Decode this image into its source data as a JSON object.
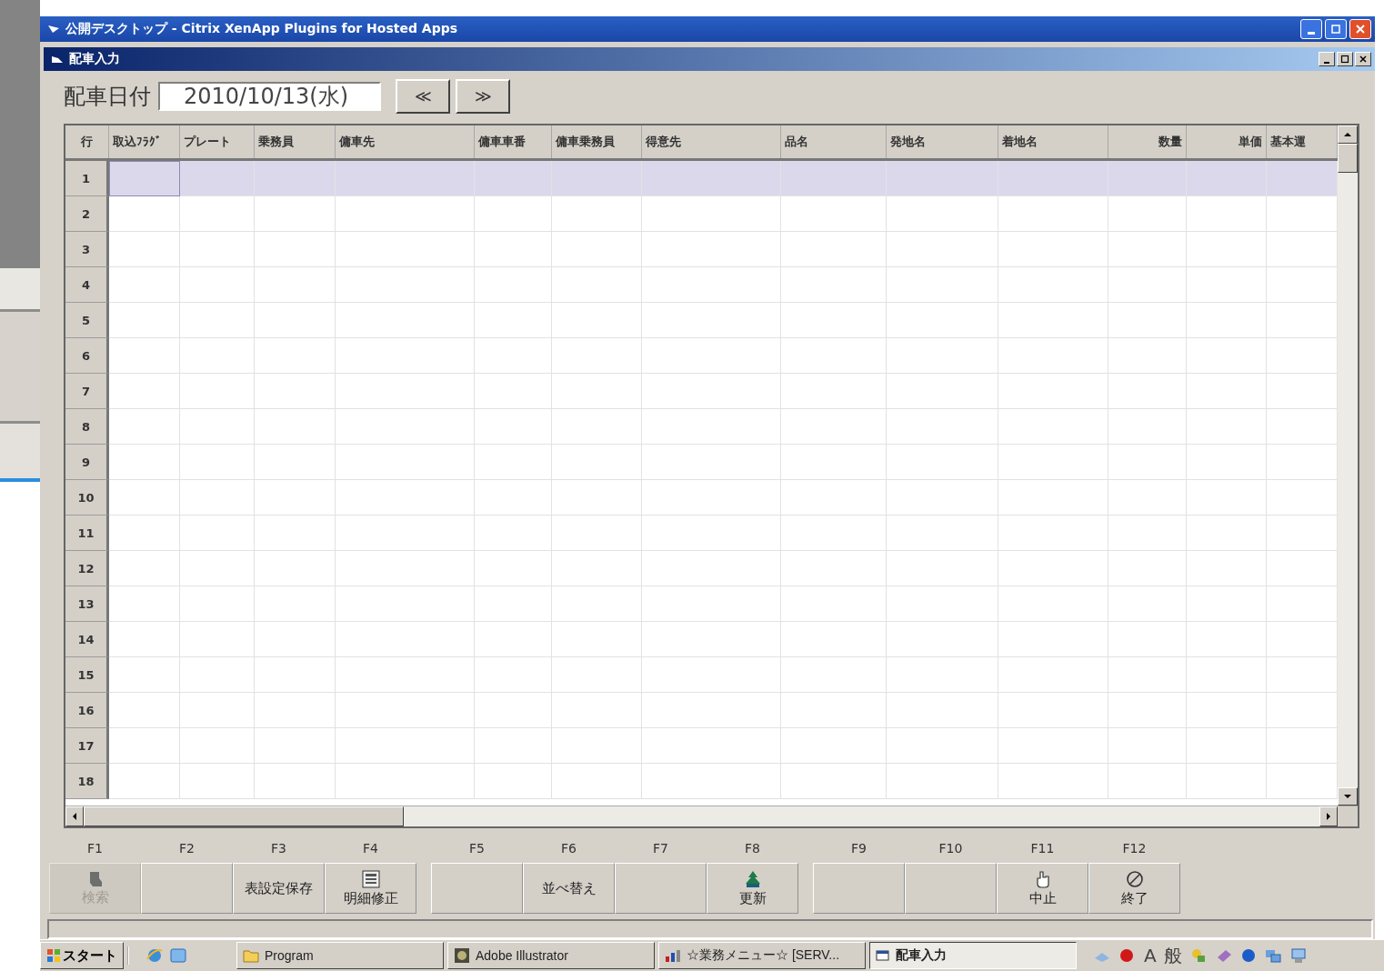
{
  "outer_window": {
    "title": "公開デスクトップ - Citrix XenApp Plugins for Hosted Apps"
  },
  "inner_window": {
    "title": "配車入力"
  },
  "date_field": {
    "label": "配車日付",
    "value": "2010/10/13(水)"
  },
  "nav_buttons": [
    "≪",
    "≫"
  ],
  "table": {
    "columns": [
      {
        "label": "行"
      },
      {
        "label": "取込ﾌﾗｸﾞ"
      },
      {
        "label": "プレート"
      },
      {
        "label": "乗務員"
      },
      {
        "label": "傭車先"
      },
      {
        "label": "傭車車番"
      },
      {
        "label": "傭車乗務員"
      },
      {
        "label": "得意先"
      },
      {
        "label": "品名"
      },
      {
        "label": "発地名"
      },
      {
        "label": "着地名"
      },
      {
        "label": "数量"
      },
      {
        "label": "単価"
      },
      {
        "label": "基本運"
      }
    ],
    "rows": [
      {
        "number": "1",
        "selected": true
      },
      {
        "number": "2",
        "selected": false
      },
      {
        "number": "3",
        "selected": false
      },
      {
        "number": "4",
        "selected": false
      },
      {
        "number": "5",
        "selected": false
      },
      {
        "number": "6",
        "selected": false
      },
      {
        "number": "7",
        "selected": false
      },
      {
        "number": "8",
        "selected": false
      },
      {
        "number": "9",
        "selected": false
      },
      {
        "number": "10",
        "selected": false
      },
      {
        "number": "11",
        "selected": false
      },
      {
        "number": "12",
        "selected": false
      },
      {
        "number": "13",
        "selected": false
      },
      {
        "number": "14",
        "selected": false
      },
      {
        "number": "15",
        "selected": false
      },
      {
        "number": "16",
        "selected": false
      },
      {
        "number": "17",
        "selected": false
      },
      {
        "number": "18",
        "selected": false
      }
    ]
  },
  "function_keys": [
    {
      "key": "F1",
      "label": "検索",
      "kind": "search",
      "disabled": true
    },
    {
      "key": "F2",
      "disabled": false
    },
    {
      "key": "F3",
      "label": "表設定保存",
      "disabled": false
    },
    {
      "key": "F4",
      "label": "明細修正",
      "kind": "form",
      "disabled": false
    },
    {
      "key": "F5",
      "disabled": false
    },
    {
      "key": "F6",
      "label": "並べ替え",
      "disabled": false
    },
    {
      "key": "F7",
      "disabled": false
    },
    {
      "key": "F8",
      "label": "更新",
      "kind": "tree",
      "disabled": false
    },
    {
      "key": "F9",
      "disabled": false
    },
    {
      "key": "F10",
      "disabled": false
    },
    {
      "key": "F11",
      "label": "中止",
      "kind": "hand",
      "disabled": false
    },
    {
      "key": "F12",
      "label": "終了",
      "kind": "stop",
      "disabled": false
    }
  ],
  "taskbar": {
    "start": "スタート",
    "tasks": [
      {
        "label": "Program",
        "kind": "folder",
        "selected": false
      },
      {
        "label": "Adobe Illustrator",
        "kind": "app",
        "selected": false
      },
      {
        "label": "☆業務メニュー☆ [SERV...",
        "kind": "chart",
        "selected": false
      },
      {
        "label": "配車入力",
        "kind": "window",
        "selected": true
      }
    ],
    "tray": [
      "A",
      "般"
    ]
  }
}
